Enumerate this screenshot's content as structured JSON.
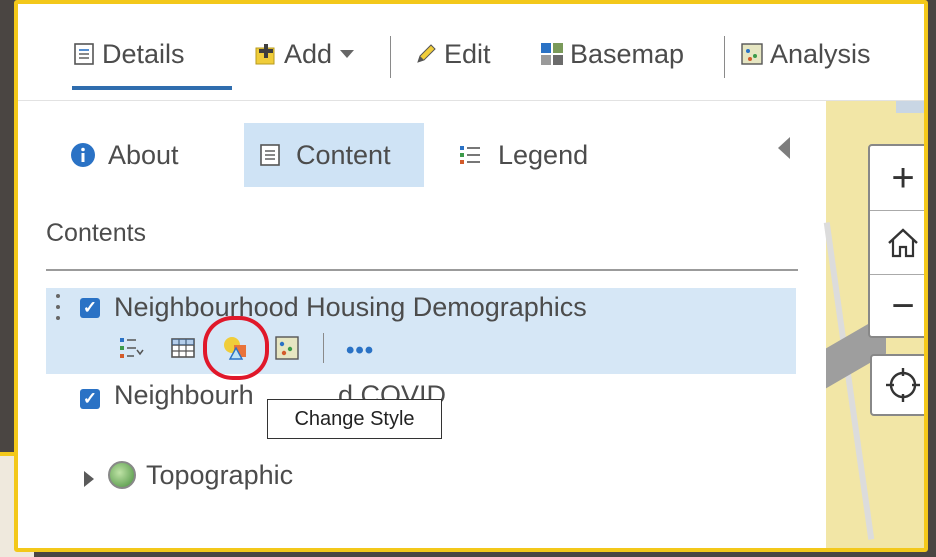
{
  "toolbar": {
    "details_label": "Details",
    "add_label": "Add",
    "edit_label": "Edit",
    "basemap_label": "Basemap",
    "analysis_label": "Analysis"
  },
  "panel_tabs": {
    "about_label": "About",
    "content_label": "Content",
    "legend_label": "Legend"
  },
  "contents": {
    "title": "Contents",
    "layers": [
      {
        "name": "Neighbourhood Housing Demographics",
        "checked": true
      },
      {
        "name": "Neighbourh",
        "name_tail": "d COVID",
        "checked": true
      }
    ],
    "basemap": {
      "name": "Topographic"
    }
  },
  "tooltip": {
    "text": "Change Style"
  },
  "colors": {
    "accent": "#2a72c5",
    "frame": "#f3c81a",
    "highlight": "#d6e7f6",
    "annotation": "#e0182a"
  }
}
